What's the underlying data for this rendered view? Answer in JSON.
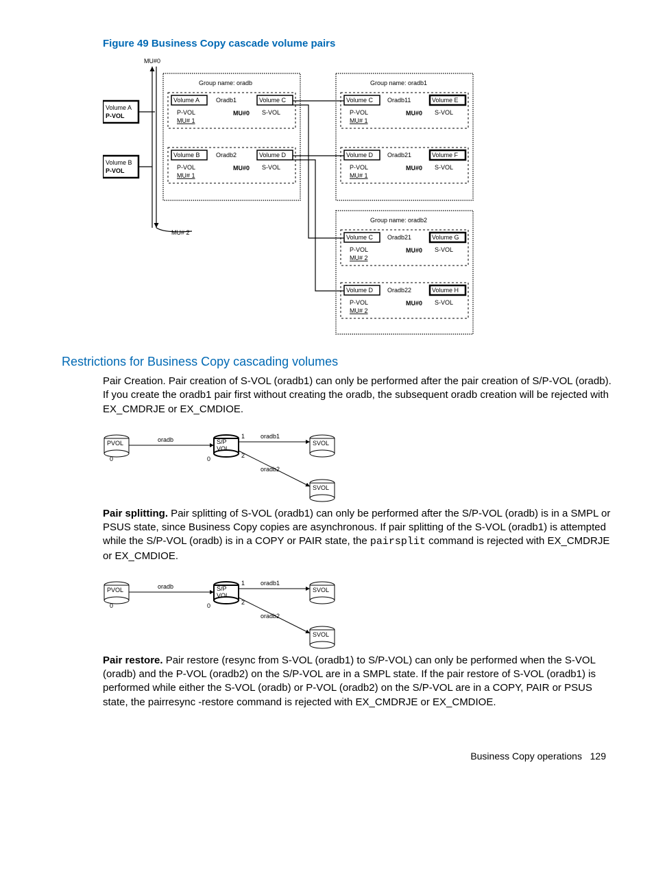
{
  "figure_title": "Figure 49 Business Copy cascade volume pairs",
  "section_title": "Restrictions for Business Copy cascading volumes",
  "pair_creation_text": "Pair Creation. Pair creation of S-VOL (oradb1) can only be performed after the pair creation of S/P-VOL (oradb). If you create the oradb1 pair first without creating the oradb, the subsequent oradb creation will be rejected with EX_CMDRJE or EX_CMDIOE.",
  "pair_splitting_bold": "Pair splitting.",
  "pair_splitting_text1": " Pair splitting of S-VOL (oradb1) can only be performed after the S/P-VOL (oradb) is in a SMPL or PSUS state, since Business Copy copies are asynchronous. If pair splitting of the S-VOL (oradb1) is attempted while the S/P-VOL (oradb) is in a COPY or PAIR state, the ",
  "pairsplit_cmd": "pairsplit",
  "pair_splitting_text2": " command is rejected with EX_CMDRJE or EX_CMDIOE.",
  "pair_restore_bold": "Pair restore.",
  "pair_restore_text": " Pair restore (resync from S-VOL (oradb1) to S/P-VOL) can only be performed when the S-VOL (oradb) and the P-VOL (oradb2) on the S/P-VOL are in a SMPL state. If the pair restore of S-VOL (oradb1) is performed while either the S-VOL (oradb) or P-VOL (oradb2) on the S/P-VOL are in a COPY, PAIR or PSUS state, the pairresync -restore command is rejected with EX_CMDRJE or EX_CMDIOE.",
  "footer_text": "Business Copy operations",
  "page_number": "129",
  "chart_data": {
    "type": "diagram",
    "figure49": {
      "mu_labels": [
        "MU#0",
        "MU#1",
        "MU#2"
      ],
      "left_volumes": [
        {
          "name": "Volume A",
          "role": "P-VOL"
        },
        {
          "name": "Volume B",
          "role": "P-VOL"
        }
      ],
      "groups": [
        {
          "name": "oradb",
          "pairs": [
            {
              "pvol": "Volume A",
              "svol": "Volume C",
              "pair_name": "Oradb1",
              "mu": "MU#0",
              "pvol_mu": "MU# 1"
            },
            {
              "pvol": "Volume B",
              "svol": "Volume D",
              "pair_name": "Oradb2",
              "mu": "MU#0",
              "pvol_mu": "MU# 1"
            }
          ]
        },
        {
          "name": "oradb1",
          "pairs": [
            {
              "pvol": "Volume C",
              "svol": "Volume E",
              "pair_name": "Oradb11",
              "mu": "MU#0",
              "pvol_mu": "MU# 1"
            },
            {
              "pvol": "Volume D",
              "svol": "Volume F",
              "pair_name": "Oradb21",
              "mu": "MU#0",
              "pvol_mu": "MU# 1"
            }
          ]
        },
        {
          "name": "oradb2",
          "pairs": [
            {
              "pvol": "Volume C",
              "svol": "Volume G",
              "pair_name": "Oradb21",
              "mu": "MU#0",
              "pvol_mu": "MU# 2"
            },
            {
              "pvol": "Volume D",
              "svol": "Volume H",
              "pair_name": "Oradb22",
              "mu": "MU#0",
              "pvol_mu": "MU# 2"
            }
          ]
        }
      ]
    },
    "small_diagram": {
      "nodes": [
        "PVOL",
        "S/P VOL",
        "SVOL",
        "SVOL"
      ],
      "edges": [
        {
          "from": "PVOL",
          "to": "S/P VOL",
          "label": "oradb",
          "mu_from": "0",
          "mu_to": "0"
        },
        {
          "from": "S/P VOL",
          "to": "SVOL",
          "label": "oradb1",
          "mu_from": "1"
        },
        {
          "from": "S/P VOL",
          "to": "SVOL",
          "label": "oradb2",
          "mu_from": "2"
        }
      ]
    }
  }
}
